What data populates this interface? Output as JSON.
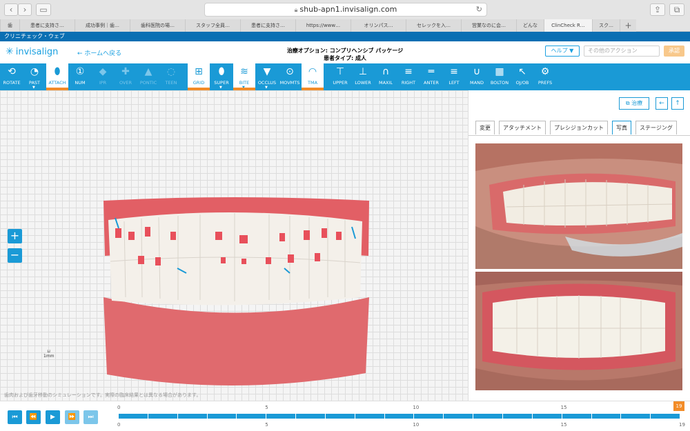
{
  "browser": {
    "url": "shub-apn1.invisalign.com",
    "tabs": [
      "歯",
      "患者に支持さ…",
      "成功事例｜歯…",
      "歯科医院の場…",
      "スタッフ全員…",
      "患者に支持さ…",
      "https://www…",
      "オリンパス…",
      "セレックを入…",
      "営業なのに会…",
      "どんな",
      "ClinCheck R…",
      "スク…"
    ]
  },
  "site_bar": "クリニチェック・ウェブ",
  "header": {
    "logo": "invisalign",
    "home_link": "← ホームへ戻る",
    "treatment_option": "治療オプション: コンプリヘンシブ パッケージ",
    "patient_type": "患者タイプ: 成人",
    "help": "ヘルプ ▼",
    "other_actions_placeholder": "その他のアクション",
    "approve": "承認"
  },
  "toolbar": [
    {
      "label": "ROTATE",
      "icon": "rotate-icon",
      "glyph": "⟲",
      "state": "normal"
    },
    {
      "label": "PAST",
      "icon": "past-icon",
      "glyph": "◔",
      "state": "normal",
      "caret": true
    },
    {
      "label": "ATTACH",
      "icon": "attach-icon",
      "glyph": "⬮",
      "state": "on"
    },
    {
      "label": "NUM",
      "icon": "num-icon",
      "glyph": "①",
      "state": "normal"
    },
    {
      "label": "IPR",
      "icon": "ipr-icon",
      "glyph": "◆",
      "state": "disabled"
    },
    {
      "label": "OVER",
      "icon": "over-icon",
      "glyph": "✚",
      "state": "disabled"
    },
    {
      "label": "PONTIC",
      "icon": "pontic-icon",
      "glyph": "▲",
      "state": "disabled"
    },
    {
      "label": "TEEN",
      "icon": "teen-icon",
      "glyph": "◌",
      "state": "disabled"
    },
    {
      "label": "GRID",
      "icon": "grid-icon",
      "glyph": "⊞",
      "state": "on"
    },
    {
      "label": "SUPER",
      "icon": "super-icon",
      "glyph": "⬮",
      "state": "normal",
      "caret": true
    },
    {
      "label": "BITE",
      "icon": "bite-icon",
      "glyph": "≋",
      "state": "on",
      "caret": true
    },
    {
      "label": "OCCLUS",
      "icon": "occlus-icon",
      "glyph": "▼",
      "state": "normal",
      "caret": true
    },
    {
      "label": "MOVMTS",
      "icon": "movmts-icon",
      "glyph": "⊙",
      "state": "normal"
    },
    {
      "label": "TMA",
      "icon": "tma-icon",
      "glyph": "◠",
      "state": "on"
    },
    {
      "label": "UPPER",
      "icon": "upper-icon",
      "glyph": "⊤",
      "state": "normal"
    },
    {
      "label": "LOWER",
      "icon": "lower-icon",
      "glyph": "⊥",
      "state": "normal"
    },
    {
      "label": "MAXIL",
      "icon": "maxil-icon",
      "glyph": "∩",
      "state": "normal"
    },
    {
      "label": "RIGHT",
      "icon": "right-icon",
      "glyph": "≡",
      "state": "normal"
    },
    {
      "label": "ANTER",
      "icon": "anter-icon",
      "glyph": "═",
      "state": "normal"
    },
    {
      "label": "LEFT",
      "icon": "left-icon",
      "glyph": "≡",
      "state": "normal"
    },
    {
      "label": "MAND",
      "icon": "mand-icon",
      "glyph": "∪",
      "state": "normal"
    },
    {
      "label": "BOLTON",
      "icon": "bolton-icon",
      "glyph": "▦",
      "state": "normal"
    },
    {
      "label": "OJ/OB",
      "icon": "ojob-icon",
      "glyph": "↖",
      "state": "normal"
    },
    {
      "label": "PREFS",
      "icon": "prefs-icon",
      "glyph": "⚙",
      "state": "normal"
    }
  ],
  "viewer": {
    "zoom_in": "+",
    "zoom_out": "−",
    "scale_label": "1mm",
    "disclaimer": "歯肉および歯牙移動のシミュレーションです。実際の臨床結果とは異なる場合があります。"
  },
  "panel": {
    "treatment_button": "治療",
    "back_glyph": "←",
    "up_glyph": "↑",
    "tabs": [
      "変更",
      "アタッチメント",
      "プレシジョンカット",
      "写真",
      "ステージング"
    ],
    "active_tab": 3
  },
  "timeline": {
    "current_stage": "19",
    "top_ticks": [
      "0",
      "5",
      "10",
      "15"
    ],
    "bottom_ticks": [
      "0",
      "5",
      "10",
      "15",
      "19"
    ],
    "stage_count": 19
  }
}
